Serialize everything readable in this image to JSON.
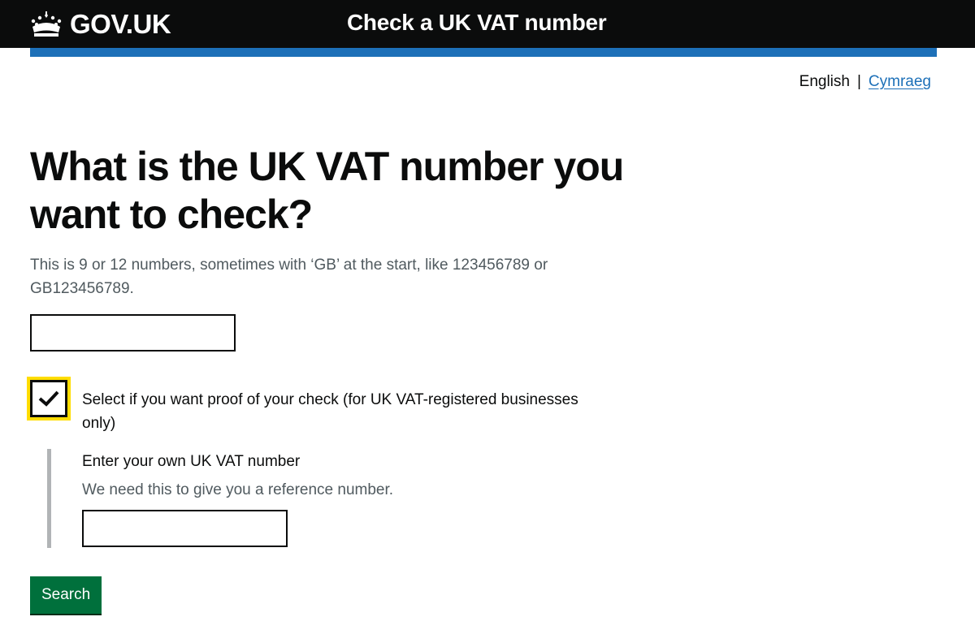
{
  "header": {
    "logo_text": "GOV.UK",
    "logo_icon": "crown-icon",
    "service_name": "Check a UK VAT number"
  },
  "language": {
    "current": "English",
    "separator": "|",
    "other": "Cymraeg"
  },
  "main": {
    "heading": "What is the UK VAT number you want to check?",
    "hint": "This is 9 or 12 numbers, sometimes with ‘GB’ at the start, like 123456789 or GB123456789.",
    "vat_input_value": "",
    "proof_checkbox": {
      "checked": true,
      "label": "Select if you want proof of your check (for UK VAT-registered businesses only)"
    },
    "own_vat": {
      "label": "Enter your own UK VAT number",
      "hint": "We need this to give you a reference number.",
      "value": ""
    },
    "search_button": "Search"
  },
  "colors": {
    "header_bg": "#0b0c0c",
    "brand_blue": "#1d70b8",
    "focus_yellow": "#ffdd00",
    "button_green": "#00703c",
    "hint_grey": "#505a5f"
  }
}
